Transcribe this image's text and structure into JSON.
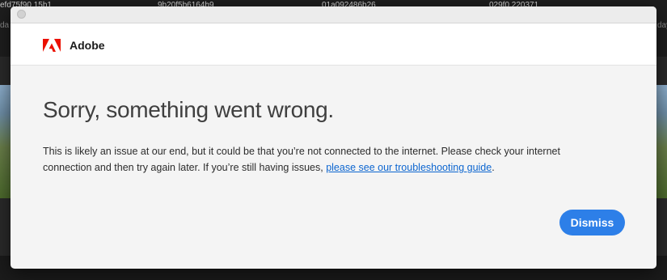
{
  "background_app": {
    "filenames": [
      "efd75f90 15b1",
      "9b20f5b6164b9",
      "01a092486b26",
      "029f0.220371"
    ],
    "sublabels": [
      "da",
      "day"
    ]
  },
  "dialog": {
    "brand": "Adobe",
    "heading": "Sorry, something went wrong.",
    "message_part1": "This is likely an issue at our end, but it could be that you’re not connected to the internet. Please check your internet connection and then try again later. If you’re still having issues, ",
    "link_text": "please see our troubleshooting guide",
    "message_end": ".",
    "dismiss_label": "Dismiss"
  },
  "colors": {
    "accent": "#2d7fe8",
    "link": "#0d66d0",
    "brand_red": "#eb1000"
  },
  "icons": {
    "logo": "adobe-logo-icon",
    "window_control": "window-close-icon"
  }
}
